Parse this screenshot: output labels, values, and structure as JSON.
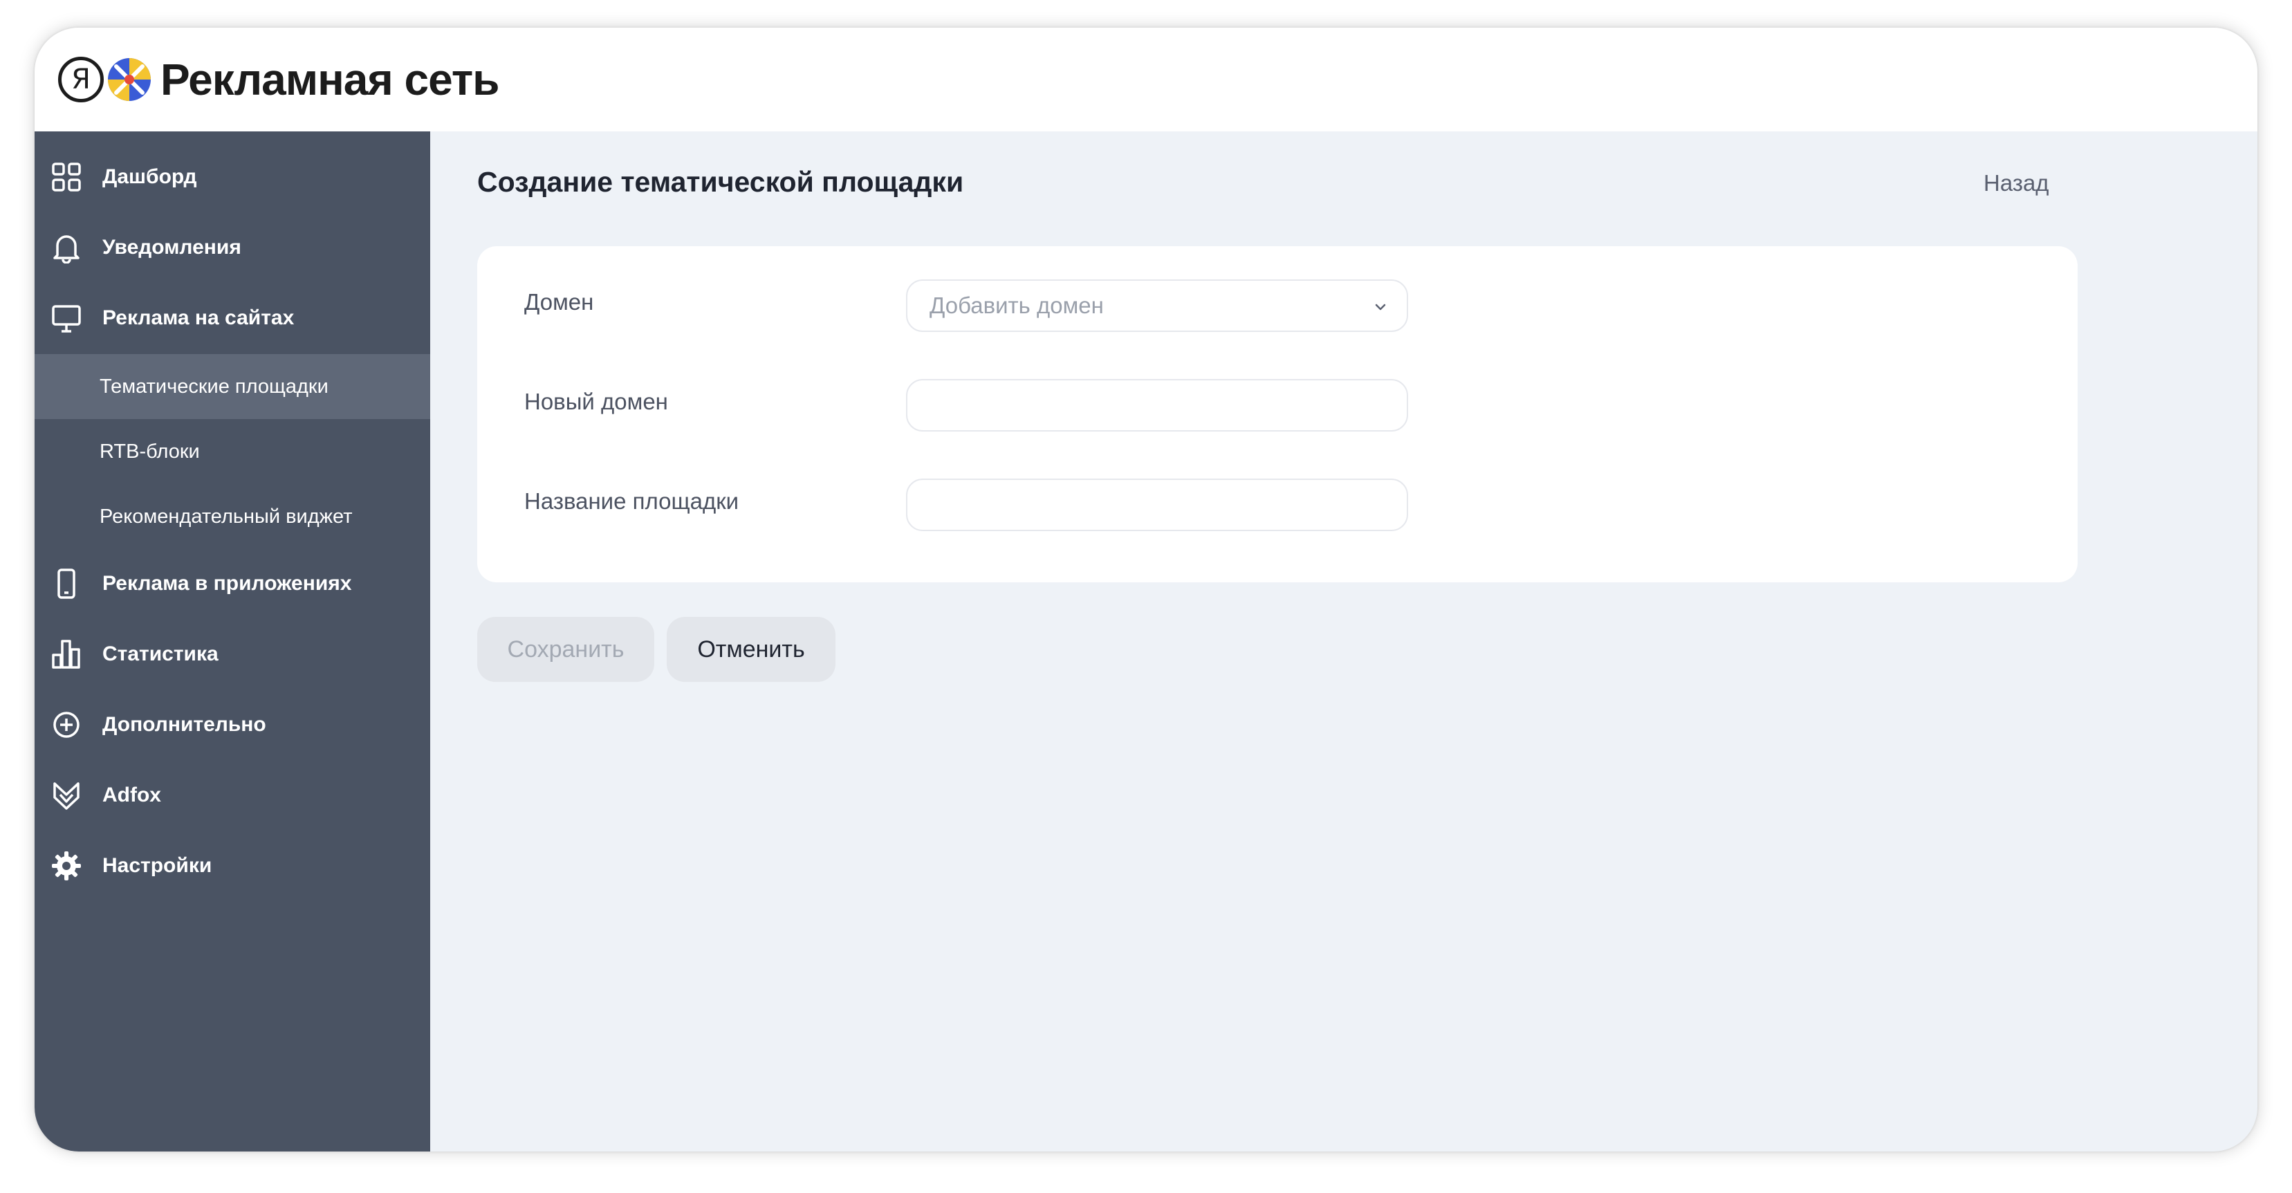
{
  "header": {
    "logo_letter": "Я",
    "brand": "Рекламная сеть"
  },
  "sidebar": {
    "items": [
      {
        "label": "Дашборд",
        "icon": "dashboard-grid-icon"
      },
      {
        "label": "Уведомления",
        "icon": "bell-icon"
      },
      {
        "label": "Реклама на сайтах",
        "icon": "monitor-icon"
      },
      {
        "label": "Реклама в приложениях",
        "icon": "phone-icon"
      },
      {
        "label": "Статистика",
        "icon": "bar-chart-icon"
      },
      {
        "label": "Дополнительно",
        "icon": "plus-circle-icon"
      },
      {
        "label": "Adfox",
        "icon": "adfox-logo-icon"
      },
      {
        "label": "Настройки",
        "icon": "gear-icon"
      }
    ],
    "subitems": [
      {
        "label": "Тематические площадки",
        "active": true
      },
      {
        "label": "RTB-блоки",
        "active": false
      },
      {
        "label": "Рекомендательный виджет",
        "active": false
      }
    ]
  },
  "main": {
    "title": "Создание тематической площадки",
    "back_label": "Назад",
    "form": {
      "domain_label": "Домен",
      "domain_placeholder": "Добавить домен",
      "new_domain_label": "Новый домен",
      "new_domain_value": "",
      "site_name_label": "Название площадки",
      "site_name_value": ""
    },
    "buttons": {
      "save": "Сохранить",
      "cancel": "Отменить"
    }
  },
  "colors": {
    "sidebar_bg": "#4a5363",
    "sidebar_active": "#5f6878",
    "content_bg": "#eef2f7",
    "text_dark": "#1f2430"
  }
}
